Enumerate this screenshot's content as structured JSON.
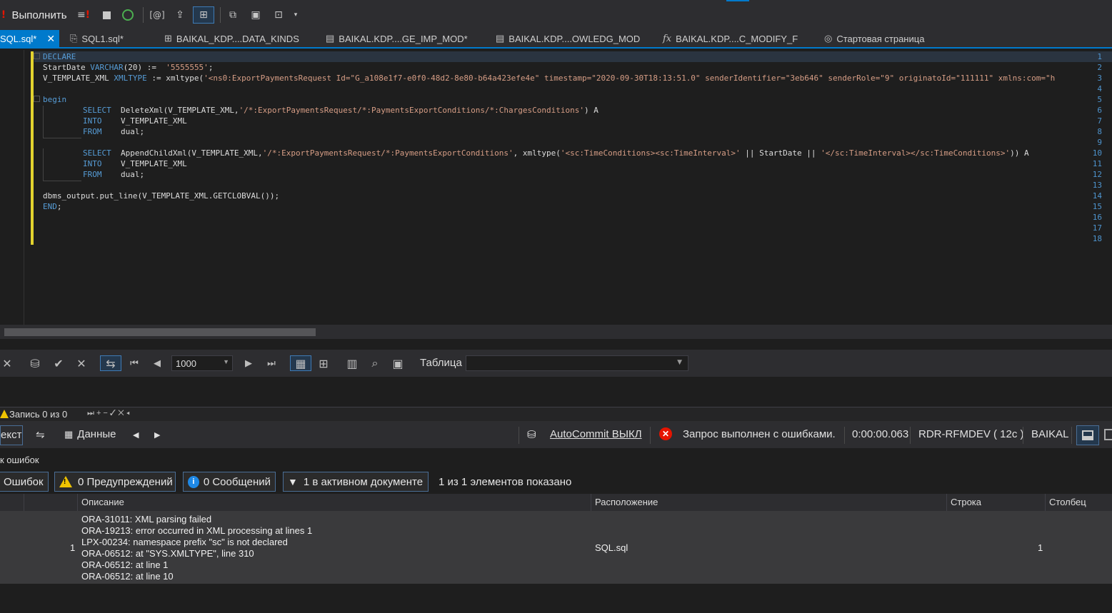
{
  "toolbar": {
    "run_label": "Выполнить"
  },
  "tabs": [
    {
      "label": "SQL.sql*",
      "icon": "sql-file-icon",
      "close": "✕"
    },
    {
      "label": "SQL1.sql*",
      "icon": "sql-file-icon"
    },
    {
      "label": "BAIKAL_KDP....DATA_KINDS",
      "icon": "table-icon"
    },
    {
      "label": "BAIKAL.KDP....GE_IMP_MOD*",
      "icon": "package-icon"
    },
    {
      "label": "BAIKAL.KDP....OWLEDG_MOD",
      "icon": "package-icon"
    },
    {
      "label": "BAIKAL.KDP....C_MODIFY_F",
      "icon": "function-icon"
    },
    {
      "label": "Стартовая страница",
      "icon": "start-page-icon"
    }
  ],
  "editor": {
    "line_numbers": [
      "1",
      "2",
      "3",
      "4",
      "5",
      "6",
      "7",
      "8",
      "9",
      "10",
      "11",
      "12",
      "13",
      "14",
      "15",
      "16",
      "17",
      "18"
    ],
    "lines": {
      "l1": {
        "kw": "DECLARE"
      },
      "l2": {
        "a": "StartDate ",
        "b": "VARCHAR",
        "c": "(20) :=  ",
        "d": "'5555555'",
        "e": ";"
      },
      "l3": {
        "a": "V_TEMPLATE_XML ",
        "b": "XMLTYPE",
        "c": " := xmltype(",
        "d": "'<ns0:ExportPaymentsRequest Id=\"G_a108e1f7-e0f0-48d2-8e80-b64a423efe4e\" timestamp=\"2020-09-30T18:13:51.0\" senderIdentifier=\"3eb646\" senderRole=\"9\" originatoId=\"111111\" xmlns:com=\"h"
      },
      "l5": {
        "kw": "begin"
      },
      "l6": {
        "kw": "SELECT",
        "a": "  DeleteXml(V_TEMPLATE_XML,",
        "d": "'/*:ExportPaymentsRequest/*:PaymentsExportConditions/*:ChargesConditions'",
        "e": ") A"
      },
      "l7": {
        "kw": "INTO",
        "a": "    V_TEMPLATE_XML"
      },
      "l8": {
        "kw": "FROM",
        "a": "    dual;"
      },
      "l10": {
        "kw": "SELECT",
        "a": "  AppendChildXml(V_TEMPLATE_XML,",
        "d": "'/*:ExportPaymentsRequest/*:PaymentsExportConditions'",
        "e": ", xmltype(",
        "f": "'<sc:TimeConditions><sc:TimeInterval>'",
        "g": " || StartDate || ",
        "h": "'</sc:TimeInterval></sc:TimeConditions>'",
        "i": ")) A"
      },
      "l11": {
        "kw": "INTO",
        "a": "    V_TEMPLATE_XML"
      },
      "l12": {
        "kw": "FROM",
        "a": "    dual;"
      },
      "l14": {
        "a": "dbms_output.put_line(V_TEMPLATE_XML.GETCLOBVAL());"
      },
      "l15": {
        "kw": "END",
        "a": ";"
      }
    }
  },
  "grid_toolbar": {
    "page_size": "1000",
    "table_label": "Таблица",
    "table_value": ""
  },
  "records": {
    "label": "Запись 0 из 0",
    "nav": "⏭ + − ✓ ✕ ◂"
  },
  "statusbar": {
    "text_tab": "екст",
    "data_tab": "Данные",
    "autocommit": "AutoCommit ВЫКЛ",
    "query_status": "Запрос выполнен с ошибками.",
    "elapsed": "0:00:00.063",
    "connection": "RDR-RFMDEV ( 12c )",
    "schema": "BAIKAL"
  },
  "error_list": {
    "header": "к ошибок",
    "filters": {
      "errors": "Ошибок",
      "warnings": "0 Предупреждений",
      "messages": "0 Сообщений",
      "active": "1 в активном документе",
      "shown": "1 из 1 элементов показано"
    },
    "columns": [
      "Описание",
      "Расположение",
      "Строка",
      "Столбец"
    ],
    "rows": [
      {
        "num": "1",
        "description": [
          "ORA-31011: XML parsing failed",
          "ORA-19213: error occurred in XML processing at lines 1",
          "LPX-00234: namespace prefix \"sc\" is not declared",
          "ORA-06512: at \"SYS.XMLTYPE\", line 310",
          "ORA-06512: at line 1",
          "ORA-06512: at line 10"
        ],
        "location": "SQL.sql",
        "line": "1",
        "column": ""
      }
    ]
  },
  "colors": {
    "accent": "#007acc",
    "keyword": "#569cd6",
    "string": "#d69d85",
    "line_number": "#4e94ce",
    "change_marker": "#e2d32e",
    "error": "#e51400",
    "warning": "#f0c400"
  }
}
